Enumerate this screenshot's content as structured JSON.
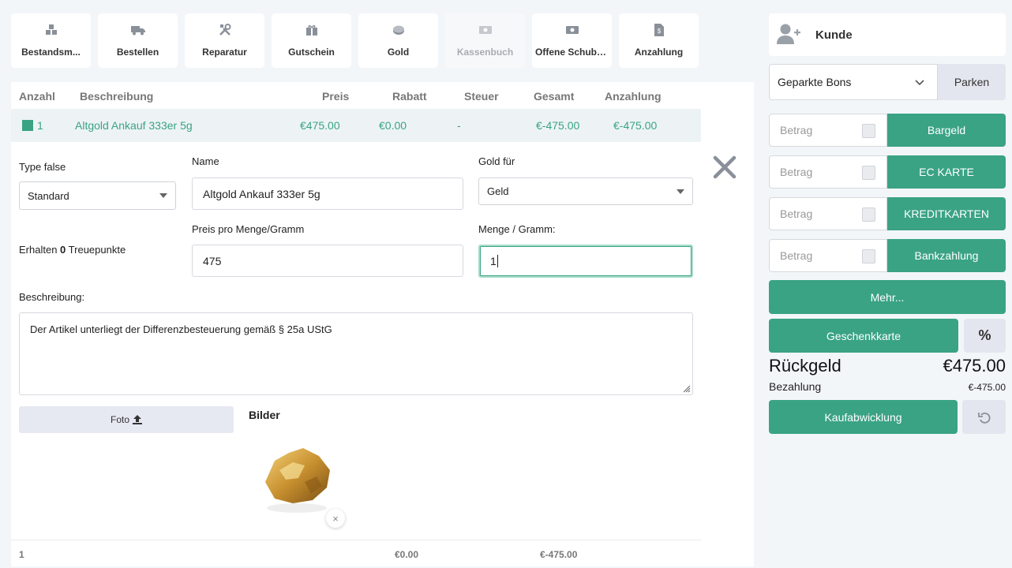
{
  "colors": {
    "accent": "#3aa384",
    "panel": "#ffffff",
    "background": "#f3f6f9"
  },
  "toolbar": {
    "tiles": [
      {
        "label": "Bestandsm...",
        "icon": "boxes-icon",
        "disabled": false
      },
      {
        "label": "Bestellen",
        "icon": "truck-icon",
        "disabled": false
      },
      {
        "label": "Reparatur",
        "icon": "tools-icon",
        "disabled": false
      },
      {
        "label": "Gutschein",
        "icon": "gift-icon",
        "disabled": false
      },
      {
        "label": "Gold",
        "icon": "coin-icon",
        "disabled": false
      },
      {
        "label": "Kassenbuch",
        "icon": "cash-icon",
        "disabled": true
      },
      {
        "label": "Offene Schublade",
        "icon": "cash-icon",
        "disabled": false
      },
      {
        "label": "Anzahlung",
        "icon": "invoice-icon",
        "disabled": false
      }
    ]
  },
  "table": {
    "headers": [
      "Anzahl",
      "Beschreibung",
      "Preis",
      "Rabatt",
      "Steuer",
      "Gesamt",
      "Anzahlung"
    ],
    "row": {
      "anzahl": "1",
      "beschreibung": "Altgold Ankauf 333er 5g",
      "preis": "€475.00",
      "rabatt": "€0.00",
      "steuer": "-",
      "gesamt": "€-475.00",
      "anzahlung": "€-475.00"
    },
    "footer": {
      "anzahl": "1",
      "rabatt": "€0.00",
      "gesamt": "€-475.00"
    }
  },
  "form": {
    "type_label": "Type false",
    "type_value": "Standard",
    "name_label": "Name",
    "name_value": "Altgold Ankauf 333er 5g",
    "gold_fuer_label": "Gold für",
    "gold_fuer_value": "Geld",
    "treue_prefix": "Erhalten",
    "treue_points": "0",
    "treue_suffix": "Treuepunkte",
    "preis_label": "Preis pro Menge/Gramm",
    "preis_value": "475",
    "menge_label": "Menge / Gramm:",
    "menge_value": "1",
    "beschreibung_label": "Beschreibung:",
    "beschreibung_value": "Der Artikel unterliegt der Differenzbesteuerung gemäß § 25a UStG",
    "foto_label": "Foto",
    "bilder_label": "Bilder",
    "remove_image": "×"
  },
  "sidebar": {
    "kunde_label": "Kunde",
    "geparkte_bons": "Geparkte Bons",
    "parken": "Parken",
    "payments": [
      {
        "placeholder": "Betrag",
        "label": "Bargeld"
      },
      {
        "placeholder": "Betrag",
        "label": "EC KARTE"
      },
      {
        "placeholder": "Betrag",
        "label": "KREDITKARTEN"
      },
      {
        "placeholder": "Betrag",
        "label": "Bankzahlung"
      }
    ],
    "mehr": "Mehr...",
    "geschenkkarte": "Geschenkkarte",
    "percent": "%",
    "rueckgeld_label": "Rückgeld",
    "rueckgeld_value": "€475.00",
    "bezahlung_label": "Bezahlung",
    "bezahlung_value": "€-475.00",
    "kaufabwicklung": "Kaufabwicklung"
  }
}
